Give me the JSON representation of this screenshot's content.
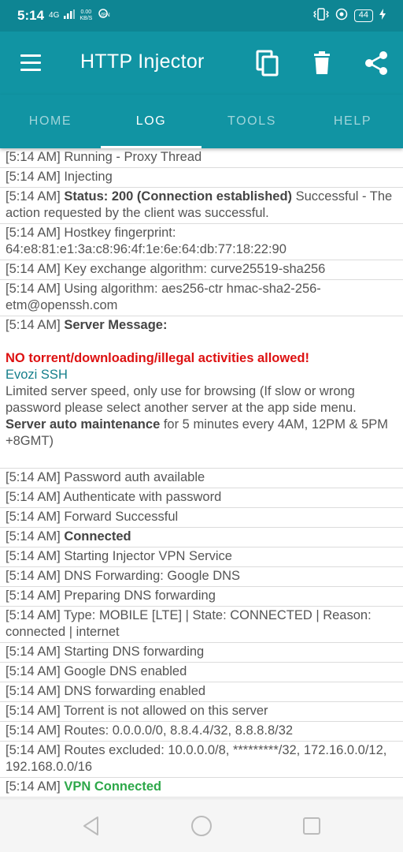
{
  "status": {
    "time": "5:14",
    "signal": "4G",
    "net_speed_value": "0.00",
    "net_speed_unit": "KB/S",
    "vpn_label": "VPN",
    "battery": "44"
  },
  "appbar": {
    "title": "HTTP Injector"
  },
  "tabs": [
    {
      "label": "HOME"
    },
    {
      "label": "LOG"
    },
    {
      "label": "TOOLS"
    },
    {
      "label": "HELP"
    }
  ],
  "log": {
    "ts": "[5:14 AM]",
    "running": "Running - Proxy Thread",
    "injecting": "Injecting",
    "status_bold": "Status: 200 (Connection established)",
    "status_rest": "Successful - The action requested by the client was successful.",
    "hostkey": "Hostkey fingerprint: 64:e8:81:e1:3a:c8:96:4f:1e:6e:64:db:77:18:22:90",
    "kex": "Key exchange algorithm: curve25519-sha256",
    "algo": "Using algorithm: aes256-ctr hmac-sha2-256-etm@openssh.com",
    "server_msg": "Server Message:",
    "warning": "NO torrent/downloading/illegal activities allowed!",
    "ssh_name": "Evozi SSH",
    "limited": "Limited server speed, only use for browsing (If slow or wrong password please select another server at the app side menu.",
    "maint_bold": "Server auto maintenance",
    "maint_rest": "for 5 minutes every 4AM, 12PM & 5PM +8GMT)",
    "pw_auth": "Password auth available",
    "auth_pw": "Authenticate with password",
    "forward": "Forward Successful",
    "connected": "Connected",
    "vpn_service": "Starting Injector VPN Service",
    "dns_fwd": "DNS Forwarding: Google DNS",
    "prep_dns": "Preparing DNS forwarding",
    "type": "Type: MOBILE [LTE] | State: CONNECTED | Reason: connected | internet",
    "start_dns": "Starting DNS forwarding",
    "google_dns": "Google DNS enabled",
    "dns_enabled": "DNS forwarding enabled",
    "torrent": "Torrent is not allowed on this server",
    "routes": "Routes: 0.0.0.0/0, 8.8.4.4/32, 8.8.8.8/32",
    "excluded": "Routes excluded: 10.0.0.0/8, *********/32, 172.16.0.0/12, 192.168.0.0/16",
    "vpn_connected": "VPN Connected"
  },
  "icons": {
    "menu": "menu-icon",
    "copy": "copy-icon",
    "delete": "trash-icon",
    "share": "share-icon",
    "back": "back-triangle-icon",
    "home": "home-circle-icon",
    "recents": "recents-square-icon"
  },
  "colors": {
    "status_bar": "#0E8593",
    "app_bar": "#1194A3",
    "warning": "#DD1111",
    "ssh_name": "#157F8B",
    "vpn_connected": "#2EA84A"
  }
}
